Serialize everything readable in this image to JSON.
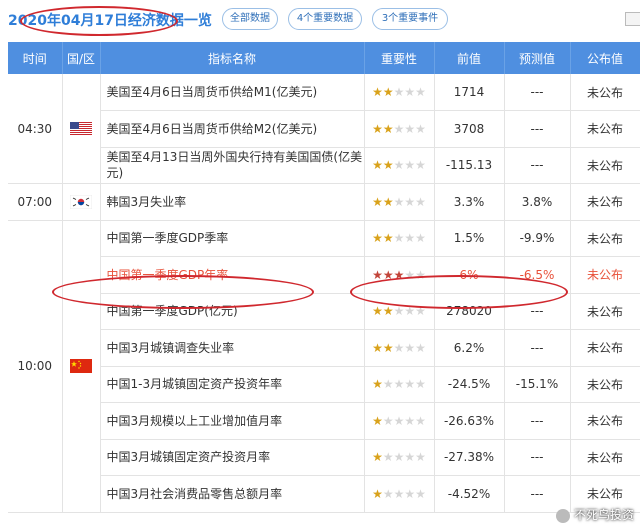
{
  "header": {
    "title": "2020年04月17日经济数据一览",
    "filters": [
      "全部数据",
      "4个重要数据",
      "3个重要事件"
    ]
  },
  "columns": [
    "时间",
    "国/区",
    "指标名称",
    "重要性",
    "前值",
    "预测值",
    "公布值"
  ],
  "groups": [
    {
      "time": "04:30",
      "country": "us-flag",
      "rows": [
        {
          "name": "美国至4月6日当周货币供给M1(亿美元)",
          "stars": 2,
          "prev": "1714",
          "forecast": "---",
          "actual": "未公布"
        },
        {
          "name": "美国至4月6日当周货币供给M2(亿美元)",
          "stars": 2,
          "prev": "3708",
          "forecast": "---",
          "actual": "未公布"
        },
        {
          "name": "美国至4月13日当周外国央行持有美国国债(亿美元)",
          "stars": 2,
          "prev": "-115.13",
          "forecast": "---",
          "actual": "未公布"
        }
      ]
    },
    {
      "time": "07:00",
      "country": "kr-flag",
      "rows": [
        {
          "name": "韩国3月失业率",
          "stars": 2,
          "prev": "3.3%",
          "forecast": "3.8%",
          "actual": "未公布"
        }
      ]
    },
    {
      "time": "10:00",
      "country": "cn-flag",
      "rows": [
        {
          "name": "中国第一季度GDP季率",
          "stars": 2,
          "prev": "1.5%",
          "forecast": "-9.9%",
          "actual": "未公布"
        },
        {
          "name": "中国第一季度GDP年率",
          "stars": 3,
          "prev": "6%",
          "forecast": "-6.5%",
          "actual": "未公布",
          "highlight": true
        },
        {
          "name": "中国第一季度GDP(亿元)",
          "stars": 2,
          "prev": "278020",
          "forecast": "---",
          "actual": "未公布"
        },
        {
          "name": "中国3月城镇调查失业率",
          "stars": 2,
          "prev": "6.2%",
          "forecast": "---",
          "actual": "未公布"
        },
        {
          "name": "中国1-3月城镇固定资产投资年率",
          "stars": 1,
          "prev": "-24.5%",
          "forecast": "-15.1%",
          "actual": "未公布"
        },
        {
          "name": "中国3月规模以上工业增加值月率",
          "stars": 1,
          "prev": "-26.63%",
          "forecast": "---",
          "actual": "未公布"
        },
        {
          "name": "中国3月城镇固定资产投资月率",
          "stars": 1,
          "prev": "-27.38%",
          "forecast": "---",
          "actual": "未公布"
        },
        {
          "name": "中国3月社会消费品零售总额月率",
          "stars": 1,
          "prev": "-4.52%",
          "forecast": "---",
          "actual": "未公布"
        }
      ]
    }
  ],
  "watermark": "不死鸟投资",
  "colors": {
    "header_bg": "#4f8fe0",
    "highlight": "#e8513a",
    "annotation": "#d0282e"
  }
}
